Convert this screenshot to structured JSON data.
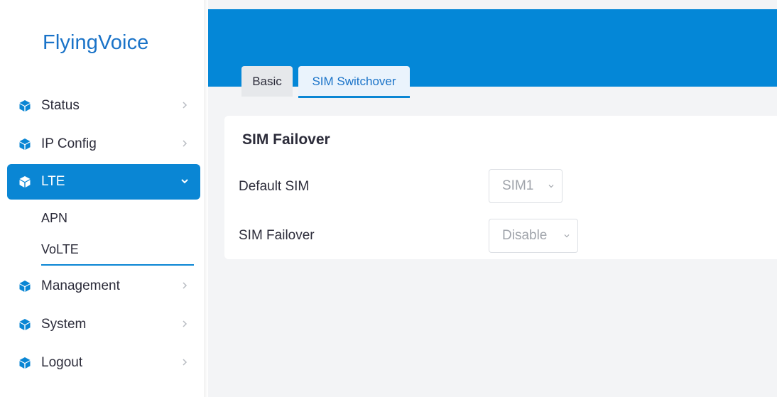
{
  "brand": {
    "logo_text": "FlyingVoice"
  },
  "sidebar": {
    "items": [
      {
        "label": "Status",
        "icon": "cube-icon"
      },
      {
        "label": "IP Config",
        "icon": "cube-icon"
      },
      {
        "label": "LTE",
        "icon": "cube-icon",
        "active": true,
        "subitems": [
          {
            "label": "APN"
          },
          {
            "label": "VoLTE",
            "active": true
          }
        ]
      },
      {
        "label": "Management",
        "icon": "cube-icon"
      },
      {
        "label": "System",
        "icon": "cube-icon"
      },
      {
        "label": "Logout",
        "icon": "cube-icon"
      }
    ]
  },
  "tabs": [
    {
      "label": "Basic"
    },
    {
      "label": "SIM Switchover",
      "active": true
    }
  ],
  "card": {
    "title": "SIM Failover",
    "fields": [
      {
        "label": "Default SIM",
        "value": "SIM1"
      },
      {
        "label": "SIM Failover",
        "value": "Disable"
      }
    ]
  },
  "colors": {
    "accent": "#0a86d4",
    "header": "#0487d7",
    "logo": "#1a73c8",
    "page_bg": "#f3f4f6"
  }
}
